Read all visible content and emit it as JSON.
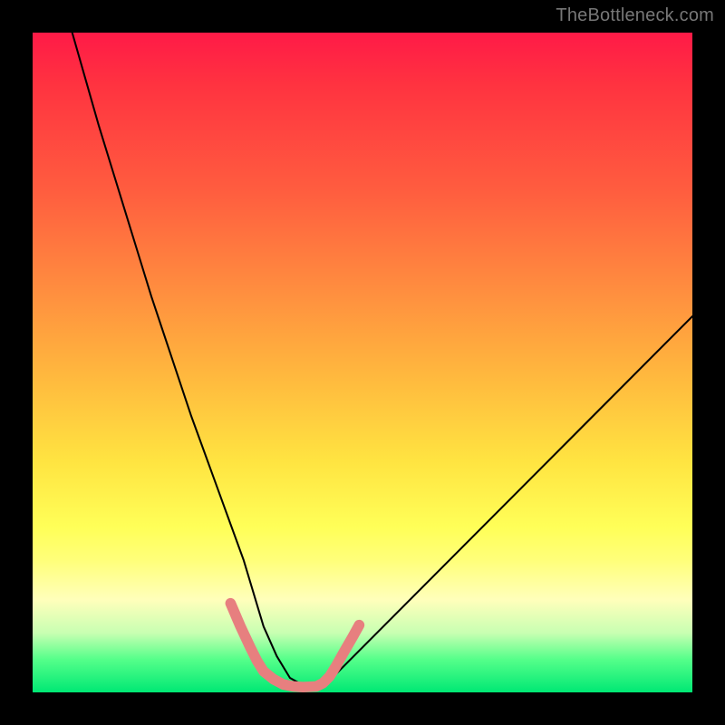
{
  "watermark": "TheBottleneck.com",
  "chart_data": {
    "type": "line",
    "title": "",
    "xlabel": "",
    "ylabel": "",
    "xlim": [
      0,
      100
    ],
    "ylim": [
      0,
      100
    ],
    "series": [
      {
        "name": "bottleneck-curve",
        "x": [
          6,
          8,
          10,
          12,
          14,
          16,
          18,
          20,
          22,
          24,
          26,
          28,
          30,
          32,
          33.5,
          35,
          37,
          39,
          41.5,
          44,
          100
        ],
        "y": [
          100,
          93,
          86,
          79.5,
          73,
          66.5,
          60,
          54,
          48,
          42,
          36.5,
          31,
          25.5,
          20,
          15,
          10,
          5.5,
          2.2,
          0.8,
          0.8,
          57
        ]
      },
      {
        "name": "highlight-segment",
        "x": [
          30,
          31.5,
          33,
          34,
          35,
          36.5,
          38,
          39.5,
          41,
          43,
          44,
          45,
          46,
          47,
          48.5,
          49.5
        ],
        "y": [
          13.5,
          10,
          6.8,
          4.8,
          3.2,
          2.0,
          1.2,
          0.9,
          0.8,
          0.9,
          1.4,
          2.4,
          4.0,
          5.8,
          8.4,
          10.2
        ]
      }
    ],
    "colors": {
      "curve": "#000000",
      "highlight": "#e77f7f"
    },
    "grid": false
  }
}
